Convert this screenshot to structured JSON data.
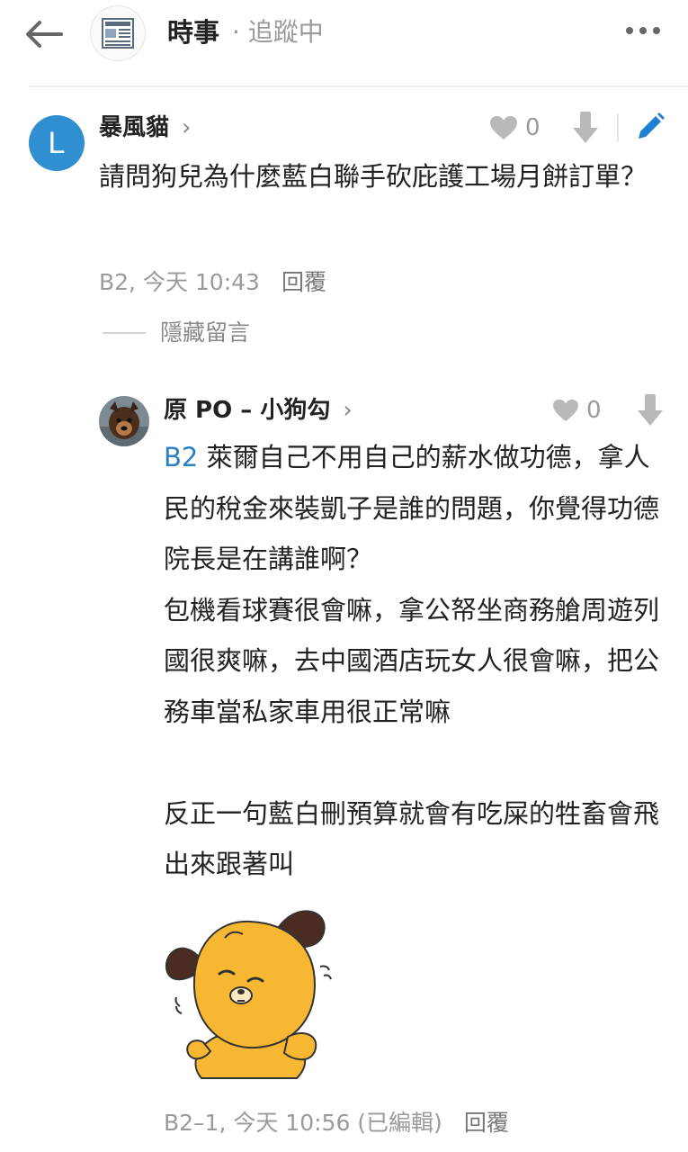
{
  "header": {
    "board_name": "時事",
    "follow_status": "· 追蹤中",
    "icons": {
      "back": "back-arrow-icon",
      "board": "newspaper-icon",
      "more": "more-horizontal-icon"
    }
  },
  "comments": [
    {
      "author": "暴風貓",
      "avatar_letter": "L",
      "avatar_color": "#2f8fd0",
      "likes": "0",
      "body": "請問狗兒為什麼藍白聯手砍庇護工場月餅訂單？",
      "floor_time": "B2, 今天 10:43",
      "reply_label": "回覆",
      "hide_label": "隱藏留言"
    },
    {
      "author": "原 PO – 小狗勾",
      "likes": "0",
      "tag": "B2",
      "paragraphs": [
        "萊爾自己不用自己的薪水做功德，拿人民的稅金來裝凱子是誰的問題，你覺得功德院長是在講誰啊？",
        "包機看球賽很會嘛，拿公帑坐商務艙周遊列國很爽嘛，去中國酒店玩女人很會嘛，把公務車當私家車用很正常嘛",
        "",
        "反正一句藍白刪預算就會有吃屎的牲畜會飛出來跟著叫"
      ],
      "floor_time": "B2–1, 今天 10:56 (已編輯)",
      "reply_label": "回覆"
    }
  ],
  "colors": {
    "accent": "#2a7fc5",
    "muted": "#9a9a9a",
    "icon_gray": "#b9b9b9",
    "edit_blue": "#1e7fd0",
    "sticker_yellow": "#f7b733"
  }
}
